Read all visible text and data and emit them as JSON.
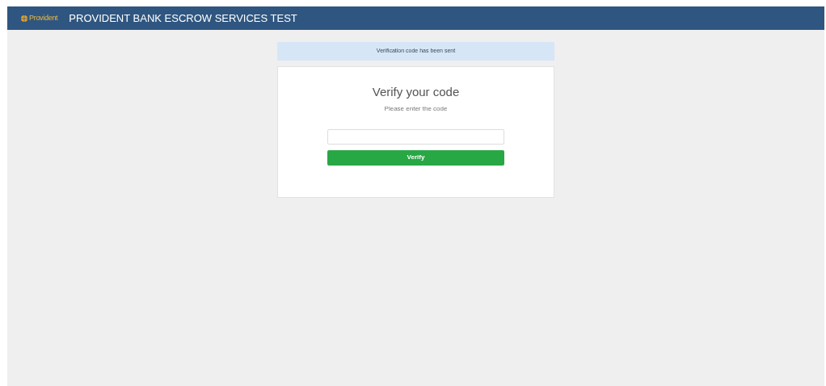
{
  "header": {
    "logo_text": "Provident",
    "title": "PROVIDENT BANK ESCROW SERVICES TEST"
  },
  "alert": {
    "message": "Verification code has been sent"
  },
  "card": {
    "heading": "Verify your code",
    "subheading": "Please enter the code",
    "button": "Verify"
  }
}
